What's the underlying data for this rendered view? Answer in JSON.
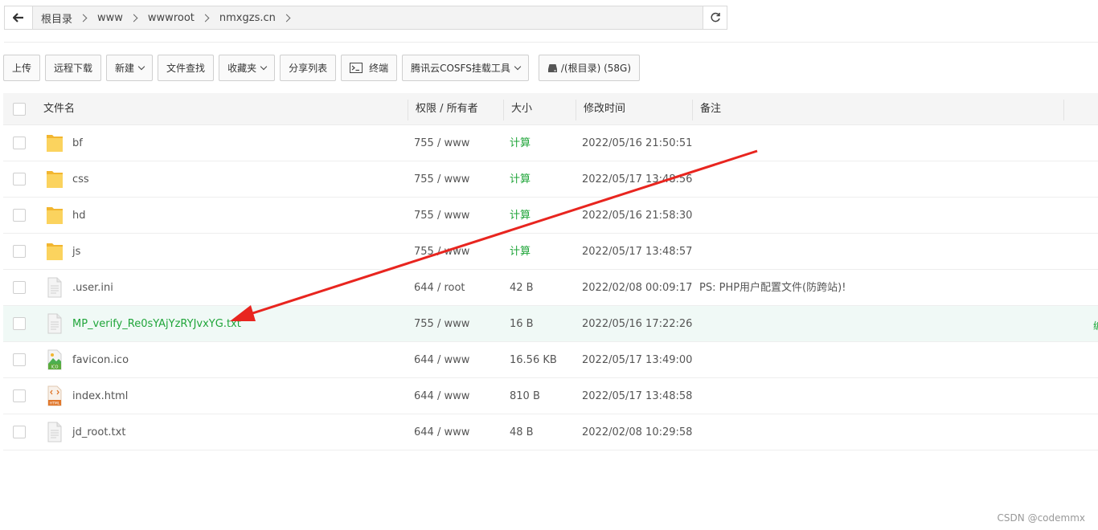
{
  "pathbar": {
    "crumbs": [
      "根目录",
      "www",
      "wwwroot",
      "nmxgzs.cn"
    ]
  },
  "toolbar": {
    "upload": "上传",
    "remote_download": "远程下载",
    "new": "新建",
    "file_search": "文件查找",
    "favorites": "收藏夹",
    "share_list": "分享列表",
    "terminal": "终端",
    "cosfs": "腾讯云COSFS挂载工具",
    "disk": "/(根目录) (58G)"
  },
  "table": {
    "headers": {
      "name": "文件名",
      "perm": "权限 / 所有者",
      "size": "大小",
      "mtime": "修改时间",
      "note": "备注"
    },
    "rows": [
      {
        "name": "bf",
        "perm": "755 / www",
        "size": "计算",
        "mtime": "2022/05/16 21:50:51",
        "note": "",
        "icon": "folder-icon"
      },
      {
        "name": "css",
        "perm": "755 / www",
        "size": "计算",
        "mtime": "2022/05/17 13:48:56",
        "note": "",
        "icon": "folder-icon"
      },
      {
        "name": "hd",
        "perm": "755 / www",
        "size": "计算",
        "mtime": "2022/05/16 21:58:30",
        "note": "",
        "icon": "folder-icon"
      },
      {
        "name": "js",
        "perm": "755 / www",
        "size": "计算",
        "mtime": "2022/05/17 13:48:57",
        "note": "",
        "icon": "folder-icon"
      },
      {
        "name": ".user.ini",
        "perm": "644 / root",
        "size": "42 B",
        "mtime": "2022/02/08 00:09:17",
        "note": "PS: PHP用户配置文件(防跨站)!",
        "icon": "file-icon"
      },
      {
        "name": "MP_verify_Re0sYAjYzRYJvxYG.txt",
        "perm": "755 / www",
        "size": "16 B",
        "mtime": "2022/05/16 17:22:26",
        "note": "",
        "icon": "file-icon"
      },
      {
        "name": "favicon.ico",
        "perm": "644 / www",
        "size": "16.56 KB",
        "mtime": "2022/05/17 13:49:00",
        "note": "",
        "icon": "image-file-icon"
      },
      {
        "name": "index.html",
        "perm": "644 / www",
        "size": "810 B",
        "mtime": "2022/05/17 13:48:58",
        "note": "",
        "icon": "html-file-icon"
      },
      {
        "name": "jd_root.txt",
        "perm": "644 / www",
        "size": "48 B",
        "mtime": "2022/02/08 10:29:58",
        "note": "",
        "icon": "file-icon"
      }
    ],
    "highlight_index": 5
  },
  "icon_labels": {
    "ico": "ICO",
    "html": "HTML"
  },
  "watermark": "CSDN @codemmx",
  "colors": {
    "accent": "#20a53a",
    "folder": "#f7c74a",
    "arrow": "#e8251f"
  }
}
